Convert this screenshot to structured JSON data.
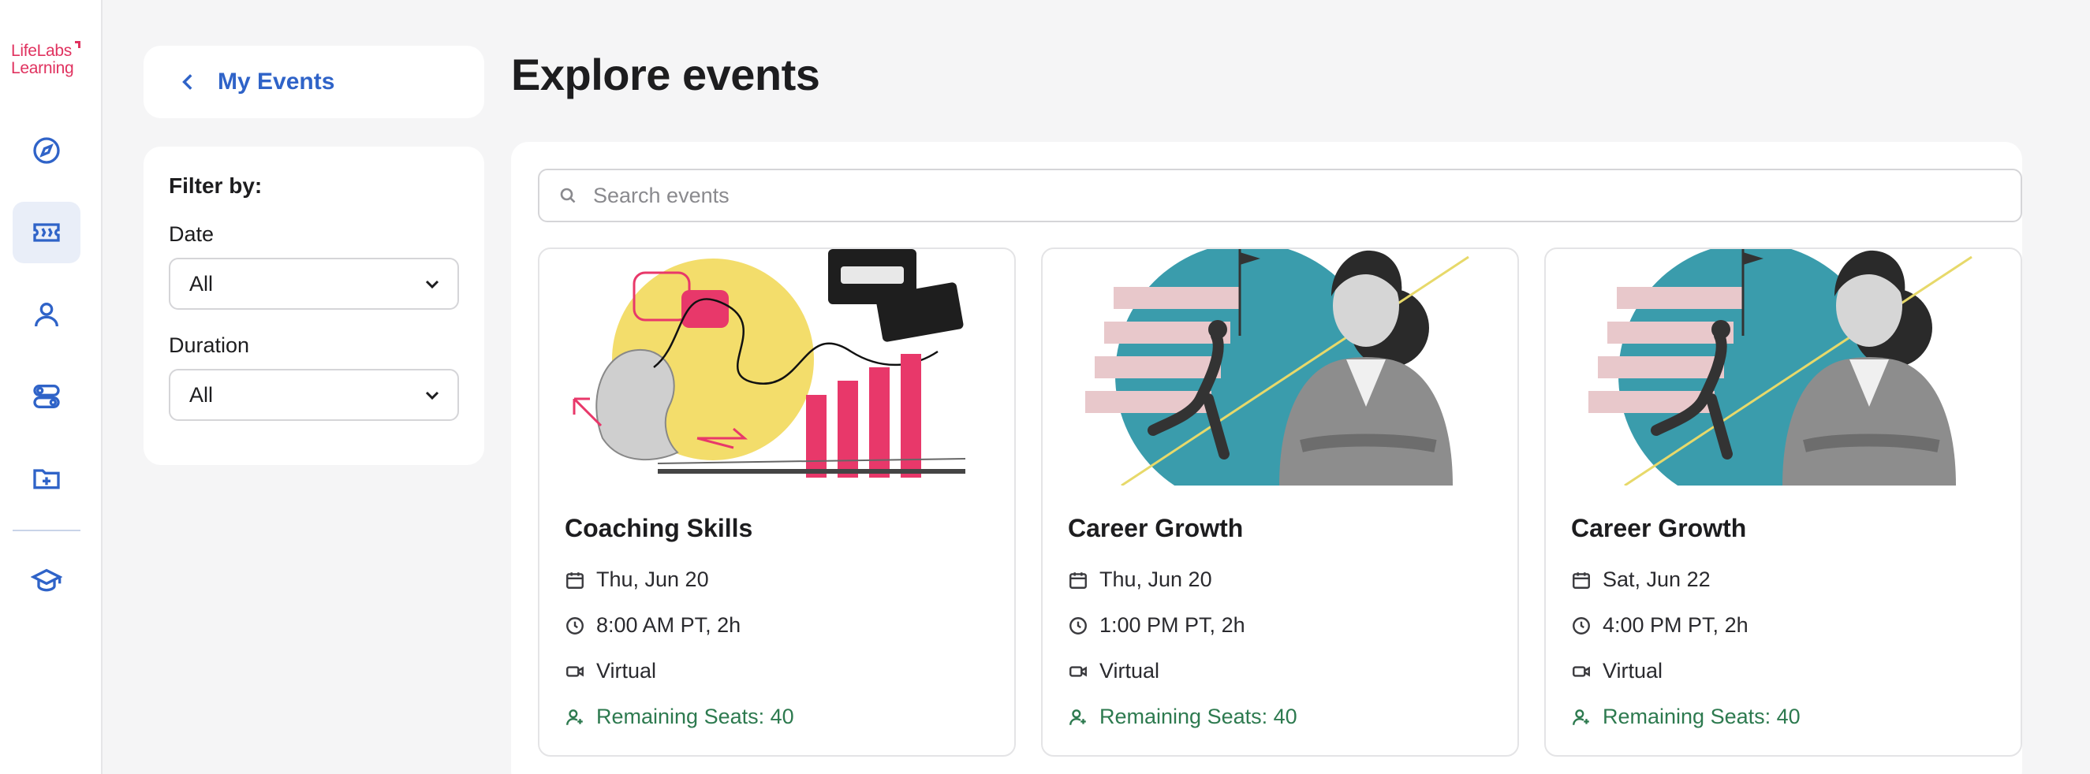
{
  "brand": {
    "line1": "LifeLabs",
    "line2": "Learning"
  },
  "back_link": {
    "label": "My Events"
  },
  "filters": {
    "title": "Filter by:",
    "date": {
      "label": "Date",
      "value": "All"
    },
    "duration": {
      "label": "Duration",
      "value": "All"
    }
  },
  "main": {
    "title": "Explore events",
    "search": {
      "placeholder": "Search events",
      "value": ""
    }
  },
  "events": [
    {
      "title": "Coaching Skills",
      "date": "Thu, Jun 20",
      "time": "8:00 AM PT, 2h",
      "format": "Virtual",
      "seats": "Remaining Seats: 40"
    },
    {
      "title": "Career Growth",
      "date": "Thu, Jun 20",
      "time": "1:00 PM PT, 2h",
      "format": "Virtual",
      "seats": "Remaining Seats: 40"
    },
    {
      "title": "Career Growth",
      "date": "Sat, Jun 22",
      "time": "4:00 PM PT, 2h",
      "format": "Virtual",
      "seats": "Remaining Seats: 40"
    }
  ],
  "colors": {
    "brand": "#e0325f",
    "accent": "#2f63c8",
    "seats": "#2d7a4f",
    "teal": "#3a9cac",
    "yellow": "#f3dd6b",
    "pink": "#e8386a"
  },
  "icons": {
    "rail": [
      "compass-icon",
      "ticket-icon",
      "user-icon",
      "toggles-icon",
      "folder-plus-icon",
      "graduation-cap-icon"
    ]
  }
}
